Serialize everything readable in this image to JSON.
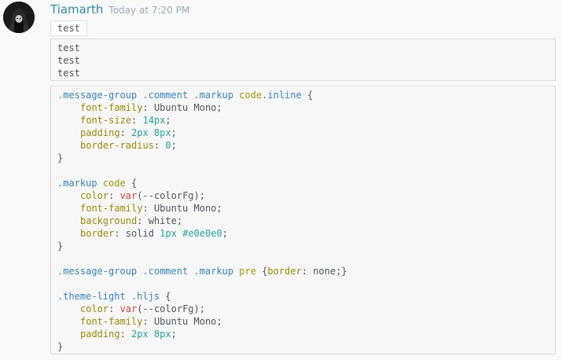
{
  "message": {
    "username": "Tiamarth",
    "timestamp": "Today at 7:20 PM",
    "avatar_icon": "hooded-figure-avatar",
    "inline_code": "test",
    "plain_block_lines": [
      "test",
      "test",
      "test"
    ]
  },
  "code": {
    "rule1": {
      "sel_a": ".message-group",
      "sel_b": ".comment",
      "sel_c": ".markup",
      "tag": "code",
      "sel_d": ".inline",
      "open": " {",
      "decls": [
        {
          "prop": "font-family",
          "value": "Ubuntu Mono"
        },
        {
          "prop": "font-size",
          "value": "14px"
        },
        {
          "prop": "padding",
          "value": "2px 8px"
        },
        {
          "prop": "border-radius",
          "value": "0"
        }
      ],
      "close": "}"
    },
    "rule2": {
      "sel_a": ".markup",
      "tag": "code",
      "open": " {",
      "decls": [
        {
          "prop": "color",
          "fn": "var",
          "value": "(--colorFg)"
        },
        {
          "prop": "font-family",
          "value": "Ubuntu Mono"
        },
        {
          "prop": "background",
          "value": "white"
        },
        {
          "prop": "border",
          "value_text": "solid ",
          "value_num": "1px",
          "value_hex": "#e0e0e0"
        }
      ],
      "close": "}"
    },
    "rule3": {
      "sel_a": ".message-group",
      "sel_b": ".comment",
      "sel_c": ".markup",
      "tag": "pre",
      "open": " {",
      "prop": "border",
      "value": "none",
      "close": ";}"
    },
    "rule4": {
      "sel_a": ".theme-light",
      "sel_b": ".hljs",
      "open": " {",
      "decls": [
        {
          "prop": "color",
          "fn": "var",
          "value": "(--colorFg)"
        },
        {
          "prop": "font-family",
          "value": "Ubuntu Mono"
        },
        {
          "prop": "padding",
          "value": "2px 8px"
        }
      ],
      "close": "}"
    }
  },
  "colors": {
    "username": "#2e8ea6",
    "timestamp": "#99aab5",
    "selector": "#3784bf",
    "property": "#9b8a00",
    "number": "#26a69a",
    "function": "#d14a3b"
  }
}
